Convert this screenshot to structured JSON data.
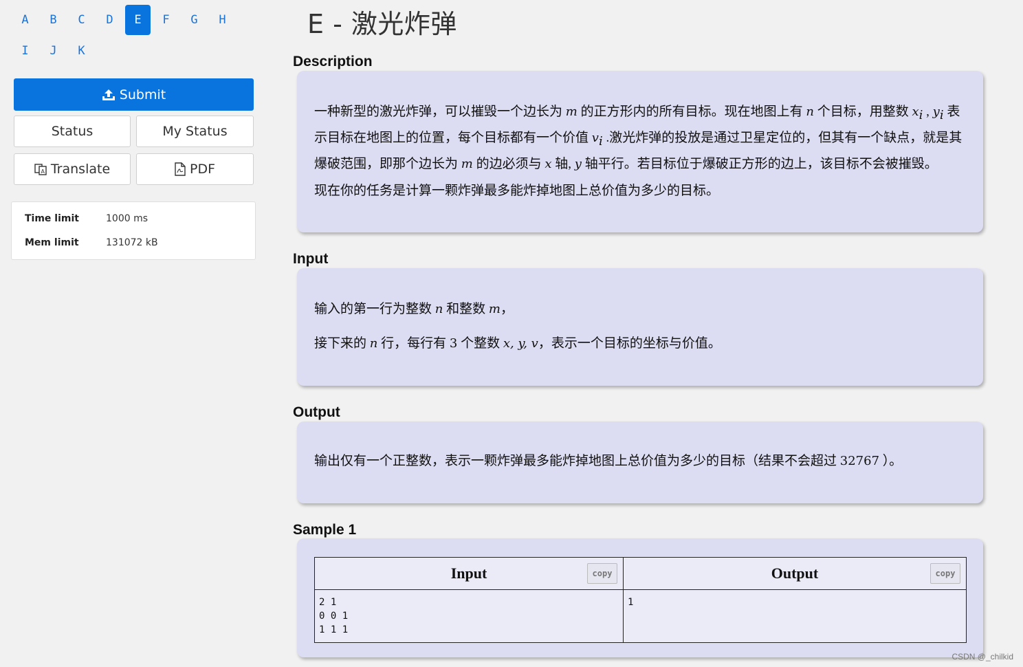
{
  "nav": {
    "letters": [
      {
        "label": "A",
        "active": false
      },
      {
        "label": "B",
        "active": false
      },
      {
        "label": "C",
        "active": false
      },
      {
        "label": "D",
        "active": false
      },
      {
        "label": "E",
        "active": true
      },
      {
        "label": "F",
        "active": false
      },
      {
        "label": "G",
        "active": false
      },
      {
        "label": "H",
        "active": false
      },
      {
        "label": "I",
        "active": false
      },
      {
        "label": "J",
        "active": false
      },
      {
        "label": "K",
        "active": false
      }
    ]
  },
  "actions": {
    "submit": "Submit",
    "status": "Status",
    "my_status": "My Status",
    "translate": "Translate",
    "pdf": "PDF"
  },
  "limits": {
    "time_label": "Time limit",
    "time_value": "1000 ms",
    "mem_label": "Mem limit",
    "mem_value": "131072 kB"
  },
  "problem": {
    "title": "E - 激光炸弹",
    "description": {
      "heading": "Description",
      "p1": {
        "t1": "一种新型的激光炸弹，可以摧毁一个边长为 ",
        "m1": "m",
        "t2": " 的正方形内的所有目标。现在地图上有 ",
        "m2": "n",
        "t3": " 个目标，用整数 ",
        "m3": "x",
        "s3": "i",
        "t4": " , ",
        "m4": "y",
        "s4": "i",
        "t5": " 表示目标在地图上的位置，每个目标都有一个价值 ",
        "m5": "v",
        "s5": "i",
        "t6": " .激光炸弹的投放是通过卫星定位的，但其有一个缺点，就是其爆破范围，即那个边长为 ",
        "m6": "m",
        "t7": " 的边必须与 ",
        "m7": "x",
        "t8": " 轴, ",
        "m8": "y",
        "t9": " 轴平行。若目标位于爆破正方形的边上，该目标不会被摧毁。"
      },
      "p2": "现在你的任务是计算一颗炸弹最多能炸掉地图上总价值为多少的目标。"
    },
    "input": {
      "heading": "Input",
      "p1": {
        "t1": "输入的第一行为整数 ",
        "m1": "n",
        "t2": " 和整数 ",
        "m2": "m",
        "t3": "，"
      },
      "p2": {
        "t1": "接下来的 ",
        "m1": "n",
        "t2": " 行，每行有 ",
        "n1": "3",
        "t3": " 个整数 ",
        "m2": "x, y, v",
        "t4": "，表示一个目标的坐标与价值。"
      }
    },
    "output": {
      "heading": "Output",
      "p1": {
        "t1": "输出仅有一个正整数，表示一颗炸弹最多能炸掉地图上总价值为多少的目标（结果不会超过 ",
        "n1": "32767",
        "t2": " ）。"
      }
    },
    "sample": {
      "heading": "Sample 1",
      "input_header": "Input",
      "output_header": "Output",
      "copy_label": "copy",
      "input_text": "2 1\n0 0 1\n1 1 1",
      "output_text": "1"
    }
  },
  "watermark": "CSDN @_chilkid",
  "colors": {
    "accent": "#0a74de",
    "card_bg": "#dcdcf2",
    "page_bg": "#f1f1f1"
  }
}
